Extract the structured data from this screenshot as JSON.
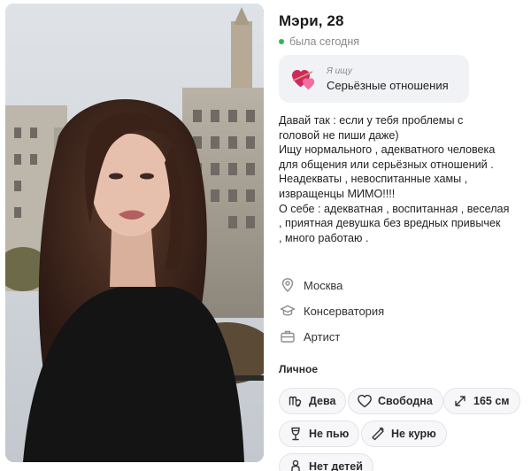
{
  "profile": {
    "name_age": "Мэри, 28",
    "status": "была сегодня",
    "status_color": "#2fb84a",
    "goal": {
      "caption": "Я ищу",
      "value": "Серьёзные отношения",
      "icon": "hearts-icon"
    },
    "about": "Давай так : если у тебя проблемы с\nголовой не пиши даже)\nИщу нормального , адекватного человека\nдля общения или серьёзных отношений .\nНеадекваты , невоспитанные хамы ,\nизвращенцы МИМО!!!!\nО себе : адекватная , воспитанная , веселая\n, приятная девушка без вредных привычек\n, много работаю .",
    "details": [
      {
        "icon": "location-pin-icon",
        "text": "Москва"
      },
      {
        "icon": "graduation-cap-icon",
        "text": "Консерватория"
      },
      {
        "icon": "briefcase-icon",
        "text": "Артист"
      }
    ],
    "personal_title": "Личное",
    "personal_tags": [
      {
        "icon": "virgo-icon",
        "text": "Дева"
      },
      {
        "icon": "heart-outline-icon",
        "text": "Свободна"
      },
      {
        "icon": "height-arrows-icon",
        "text": "165 см"
      },
      {
        "icon": "wine-glass-icon",
        "text": "Не пью"
      },
      {
        "icon": "no-smoking-icon",
        "text": "Не курю"
      },
      {
        "icon": "baby-icon",
        "text": "Нет детей"
      }
    ]
  }
}
